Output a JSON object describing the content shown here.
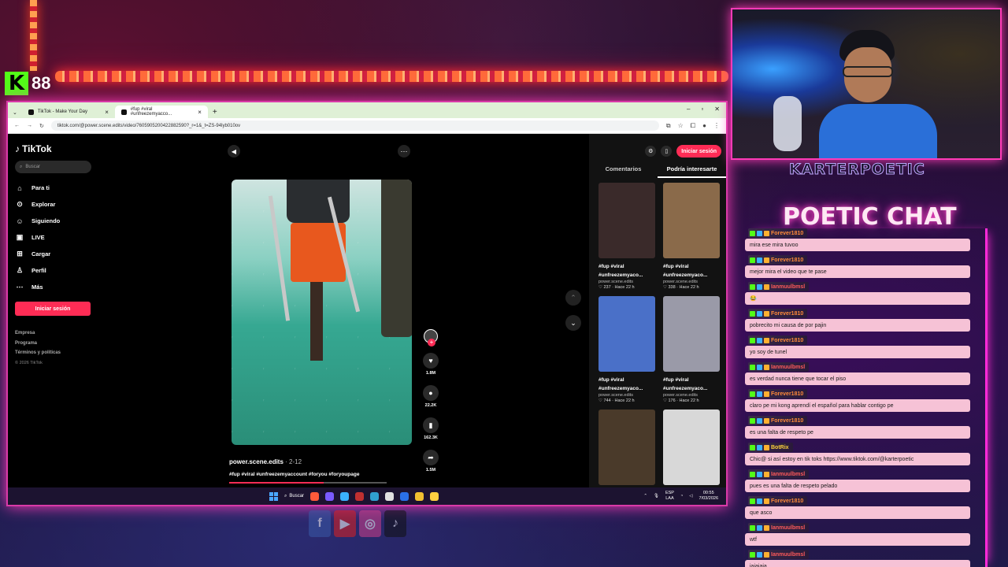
{
  "stream": {
    "kick_count": "88",
    "streamer_name": "KARTERPOETIC",
    "chat_title": "POETIC CHAT"
  },
  "browser": {
    "tabs": [
      {
        "title": "TikTok - Make Your Day"
      },
      {
        "title": "#fup #viral #unfreezemyacco..."
      }
    ],
    "url": "tiktok.com/@power.scene.edits/video/7605905200422882590?_r=1&_t=ZS-94lyb010ov"
  },
  "tiktok": {
    "logo": "TikTok",
    "search_placeholder": "Buscar",
    "nav": [
      {
        "label": "Para ti",
        "icon": "home-icon",
        "glyph": "⌂"
      },
      {
        "label": "Explorar",
        "icon": "compass-icon",
        "glyph": "⊙"
      },
      {
        "label": "Siguiendo",
        "icon": "following-icon",
        "glyph": "☺"
      },
      {
        "label": "LIVE",
        "icon": "live-icon",
        "glyph": "▣"
      },
      {
        "label": "Cargar",
        "icon": "upload-icon",
        "glyph": "⊞"
      },
      {
        "label": "Perfil",
        "icon": "profile-icon",
        "glyph": "♙"
      },
      {
        "label": "Más",
        "icon": "more-icon",
        "glyph": "⋯"
      }
    ],
    "login_label": "Iniciar sesión",
    "footer": [
      "Empresa",
      "Programa",
      "Términos y políticas"
    ],
    "copyright": "© 2026 TikTok",
    "video": {
      "author": "power.scene.edits",
      "date": " · 2-12",
      "tags": "#fup #viral #unfreezemyaccount #foryou #foryoupage",
      "likes": "1.8M",
      "comments": "22.2K",
      "saves": "162.3K",
      "shares": "1.5M",
      "progress": 0.6
    },
    "panel": {
      "login_label": "Iniciar sesión",
      "tabs": [
        "Comentarios",
        "Podría interesarte"
      ],
      "cards": [
        {
          "caption1": "#fup #viral",
          "caption2": "#unfreezemyaco...",
          "user": "power.scene.edits",
          "stats": "♡ 237 · Hace 22 h",
          "color": "#3a2a2a"
        },
        {
          "caption1": "#fup #viral",
          "caption2": "#unfreezemyaco...",
          "user": "power.scene.edits",
          "stats": "♡ 338 · Hace 22 h",
          "color": "#8a6a4a"
        },
        {
          "caption1": "#fup #viral",
          "caption2": "#unfreezemyaco...",
          "user": "power.scene.edits",
          "stats": "♡ 744 · Hace 22 h",
          "color": "#4a70c8"
        },
        {
          "caption1": "#fup #viral",
          "caption2": "#unfreezemyaco...",
          "user": "power.scene.edits",
          "stats": "♡ 176 · Hace 22 h",
          "color": "#9a9aa8"
        },
        {
          "caption1": "",
          "caption2": "",
          "user": "",
          "stats": "",
          "color": "#4a3a2a"
        },
        {
          "caption1": "",
          "caption2": "",
          "user": "",
          "stats": "",
          "color": "#d8d8d8"
        }
      ]
    }
  },
  "taskbar": {
    "search_label": "Buscar",
    "lang": "ESP\nLAA",
    "time": "00:55",
    "date": "7/03/2026"
  },
  "chat": [
    {
      "user": "Forever1810",
      "text": "mira ese mira tuvoo",
      "user_color": "#ff8a3a"
    },
    {
      "user": "Forever1810",
      "text": "mejor mira el video que te pase",
      "user_color": "#ff8a3a"
    },
    {
      "user": "Ianmuulbmsl",
      "text": "😂",
      "user_color": "#ff5a5a"
    },
    {
      "user": "Forever1810",
      "text": "pobrecito mi causa de por pajin",
      "user_color": "#ff8a3a"
    },
    {
      "user": "Forever1810",
      "text": "yo soy de tunel",
      "user_color": "#ff8a3a"
    },
    {
      "user": "Ianmuulbmsl",
      "text": "es verdad nunca tiene que tocar el piso",
      "user_color": "#ff5a5a"
    },
    {
      "user": "Forever1810",
      "text": "claro pe mi kong aprendí el español para hablar contigo pe",
      "user_color": "#ff8a3a"
    },
    {
      "user": "Forever1810",
      "text": "es una falta de respeto pe",
      "user_color": "#ff8a3a"
    },
    {
      "user": "BotRix",
      "text": "Chic@ si así estoy en tik toks https://www.tiktok.com/@karterpoetic",
      "user_color": "#ffd23a"
    },
    {
      "user": "Ianmuulbmsl",
      "text": "pues es una falta de respeto pelado",
      "user_color": "#ff5a5a"
    },
    {
      "user": "Forever1810",
      "text": "que asco",
      "user_color": "#ff8a3a"
    },
    {
      "user": "Ianmuulbmsl",
      "text": "wtf",
      "user_color": "#ff5a5a"
    },
    {
      "user": "Ianmuulbmsl",
      "text": "jajajaja",
      "user_color": "#ff5a5a"
    }
  ]
}
